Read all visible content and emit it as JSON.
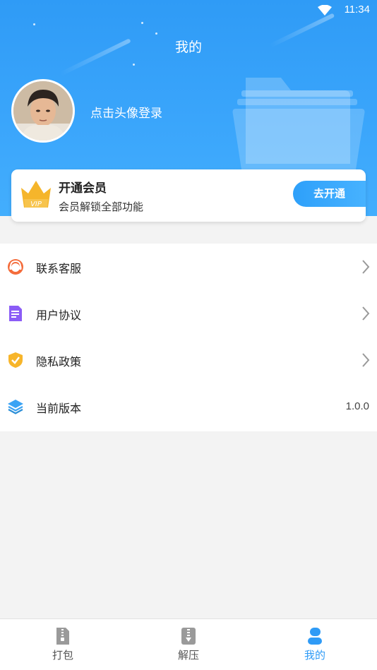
{
  "status_bar": {
    "time": "11:34",
    "wifi_icon": "wifi-icon"
  },
  "header": {
    "title": "我的",
    "login_prompt": "点击头像登录"
  },
  "vip": {
    "title": "开通会员",
    "subtitle": "会员解锁全部功能",
    "button_label": "去开通",
    "badge_text": "VIP"
  },
  "menu": {
    "items": [
      {
        "label": "联系客服",
        "icon": "customer-service-icon",
        "value": ""
      },
      {
        "label": "用户协议",
        "icon": "document-icon",
        "value": ""
      },
      {
        "label": "隐私政策",
        "icon": "shield-check-icon",
        "value": ""
      },
      {
        "label": "当前版本",
        "icon": "layers-icon",
        "value": "1.0.0"
      }
    ]
  },
  "tabbar": {
    "active_index": 2,
    "tabs": [
      {
        "label": "打包",
        "icon": "zip-file-icon"
      },
      {
        "label": "解压",
        "icon": "unzip-icon"
      },
      {
        "label": "我的",
        "icon": "user-icon"
      }
    ]
  },
  "colors": {
    "primary": "#2f9bf6",
    "vip_gold": "#f5b52b",
    "background": "#f3f3f3"
  }
}
